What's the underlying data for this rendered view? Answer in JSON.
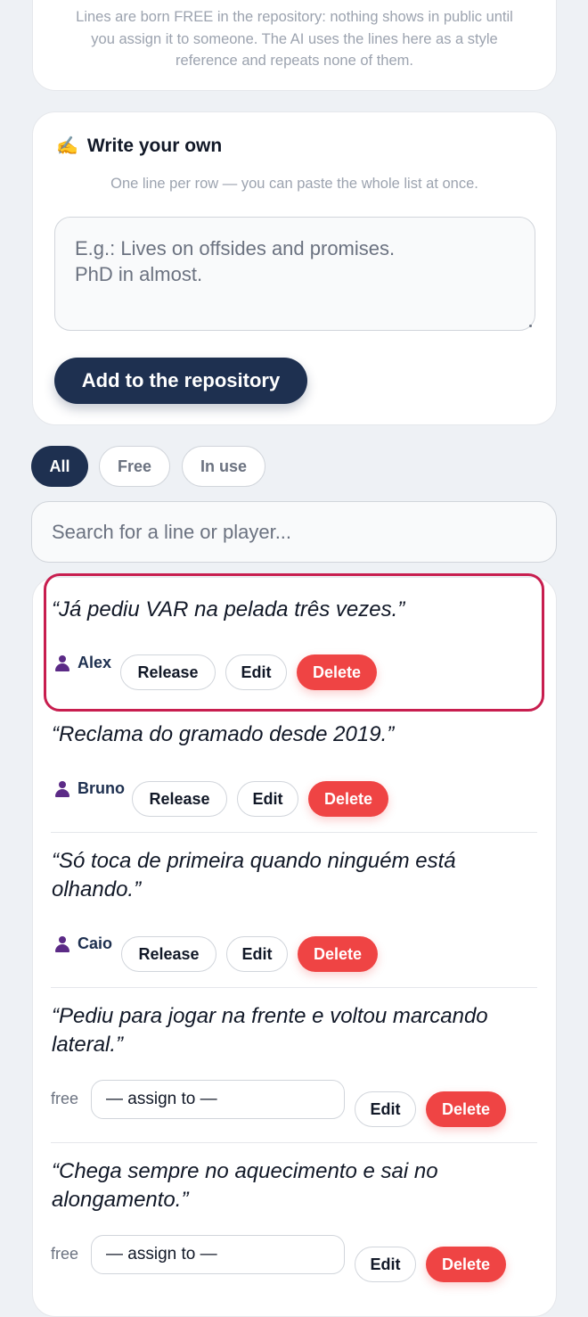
{
  "intro": {
    "text": "Lines are born FREE in the repository: nothing shows in public until you assign it to someone. The AI uses the lines here as a style reference and repeats none of them."
  },
  "write_card": {
    "emoji": "✍️",
    "title": "Write your own",
    "subtitle": "One line per row — you can paste the whole list at once.",
    "placeholder": "E.g.: Lives on offsides and promises.\nPhD in almost.",
    "add_button": "Add to the repository"
  },
  "filters": {
    "all": "All",
    "free": "Free",
    "in_use": "In use",
    "active": "all"
  },
  "search": {
    "placeholder": "Search for a line or player..."
  },
  "lines": [
    {
      "quote": "“Já pediu VAR na pelada três vezes.”",
      "status": "assigned",
      "player": "Alex",
      "release": "Release",
      "edit": "Edit",
      "delete": "Delete"
    },
    {
      "quote": "“Reclama do gramado desde 2019.”",
      "status": "assigned",
      "player": "Bruno",
      "release": "Release",
      "edit": "Edit",
      "delete": "Delete"
    },
    {
      "quote": "“Só toca de primeira quando ninguém está olhando.”",
      "status": "assigned",
      "player": "Caio",
      "release": "Release",
      "edit": "Edit",
      "delete": "Delete"
    },
    {
      "quote": "“Pediu para jogar na frente e voltou marcando lateral.”",
      "status": "free",
      "status_label": "free",
      "assign_value": "— assign to —",
      "edit": "Edit",
      "delete": "Delete"
    },
    {
      "quote": "“Chega sempre no aquecimento e sai no alongamento.”",
      "status": "free",
      "status_label": "free",
      "assign_value": "— assign to —",
      "edit": "Edit",
      "delete": "Delete"
    }
  ],
  "colors": {
    "navy": "#1e3050",
    "delete_red": "#ef4444",
    "highlight_border": "#c81e4f",
    "person_icon": "#5b2a86"
  }
}
